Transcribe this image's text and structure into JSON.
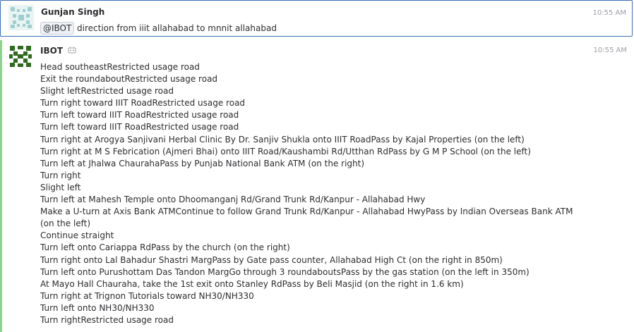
{
  "messages": [
    {
      "sender": "Gunjan Singh",
      "time": "10:55 AM",
      "mention": "@IBOT",
      "text": "direction from iiit allahabad to mnnit allahabad"
    },
    {
      "sender": "IBOT",
      "time": "10:55 AM",
      "lines": [
        "Head southeastRestricted usage road",
        "Exit the roundaboutRestricted usage road",
        "Slight leftRestricted usage road",
        "Turn right toward IIIT RoadRestricted usage road",
        "Turn left toward IIIT RoadRestricted usage road",
        "Turn left toward IIIT RoadRestricted usage road",
        "Turn right at Arogya Sanjivani Herbal Clinic By Dr. Sanjiv Shukla onto IIIT RoadPass by Kajal Properties (on the left)",
        "Turn right at M S Febrication (Ajmeri Bhai) onto IIIT Road/Kaushambi Rd/Utthan RdPass by G M P School (on the left)",
        "Turn left at Jhalwa ChaurahaPass by Punjab National Bank ATM (on the right)",
        "Turn right",
        "Slight left",
        "Turn left at Mahesh Temple onto Dhoomanganj Rd/Grand Trunk Rd/Kanpur - Allahabad Hwy",
        "Make a U-turn at Axis Bank ATMContinue to follow Grand Trunk Rd/Kanpur - Allahabad HwyPass by Indian Overseas Bank ATM (on the left)",
        "Continue straight",
        "Turn left onto Cariappa RdPass by the church (on the right)",
        "Turn right onto Lal Bahadur Shastri MargPass by Gate pass counter, Allahabad High Ct (on the right in 850m)",
        "Turn left onto Purushottam Das Tandon MargGo through 3 roundaboutsPass by the gas station (on the left in 350m)",
        "At Mayo Hall Chauraha, take the 1st exit onto Stanley RdPass by Beli Masjid (on the right in 1.6 km)",
        "Turn right at Trignon Tutorials toward NH30/NH330",
        "Turn left onto NH30/NH330",
        "Turn rightRestricted usage road"
      ]
    }
  ],
  "colors": {
    "selected_border": "#3b6fb3",
    "bot_accent": "#8fd28e",
    "timestamp": "#9e9ea6"
  },
  "icons": [
    "user-avatar-identicon",
    "bot-avatar-identicon",
    "bot-badge-icon"
  ]
}
